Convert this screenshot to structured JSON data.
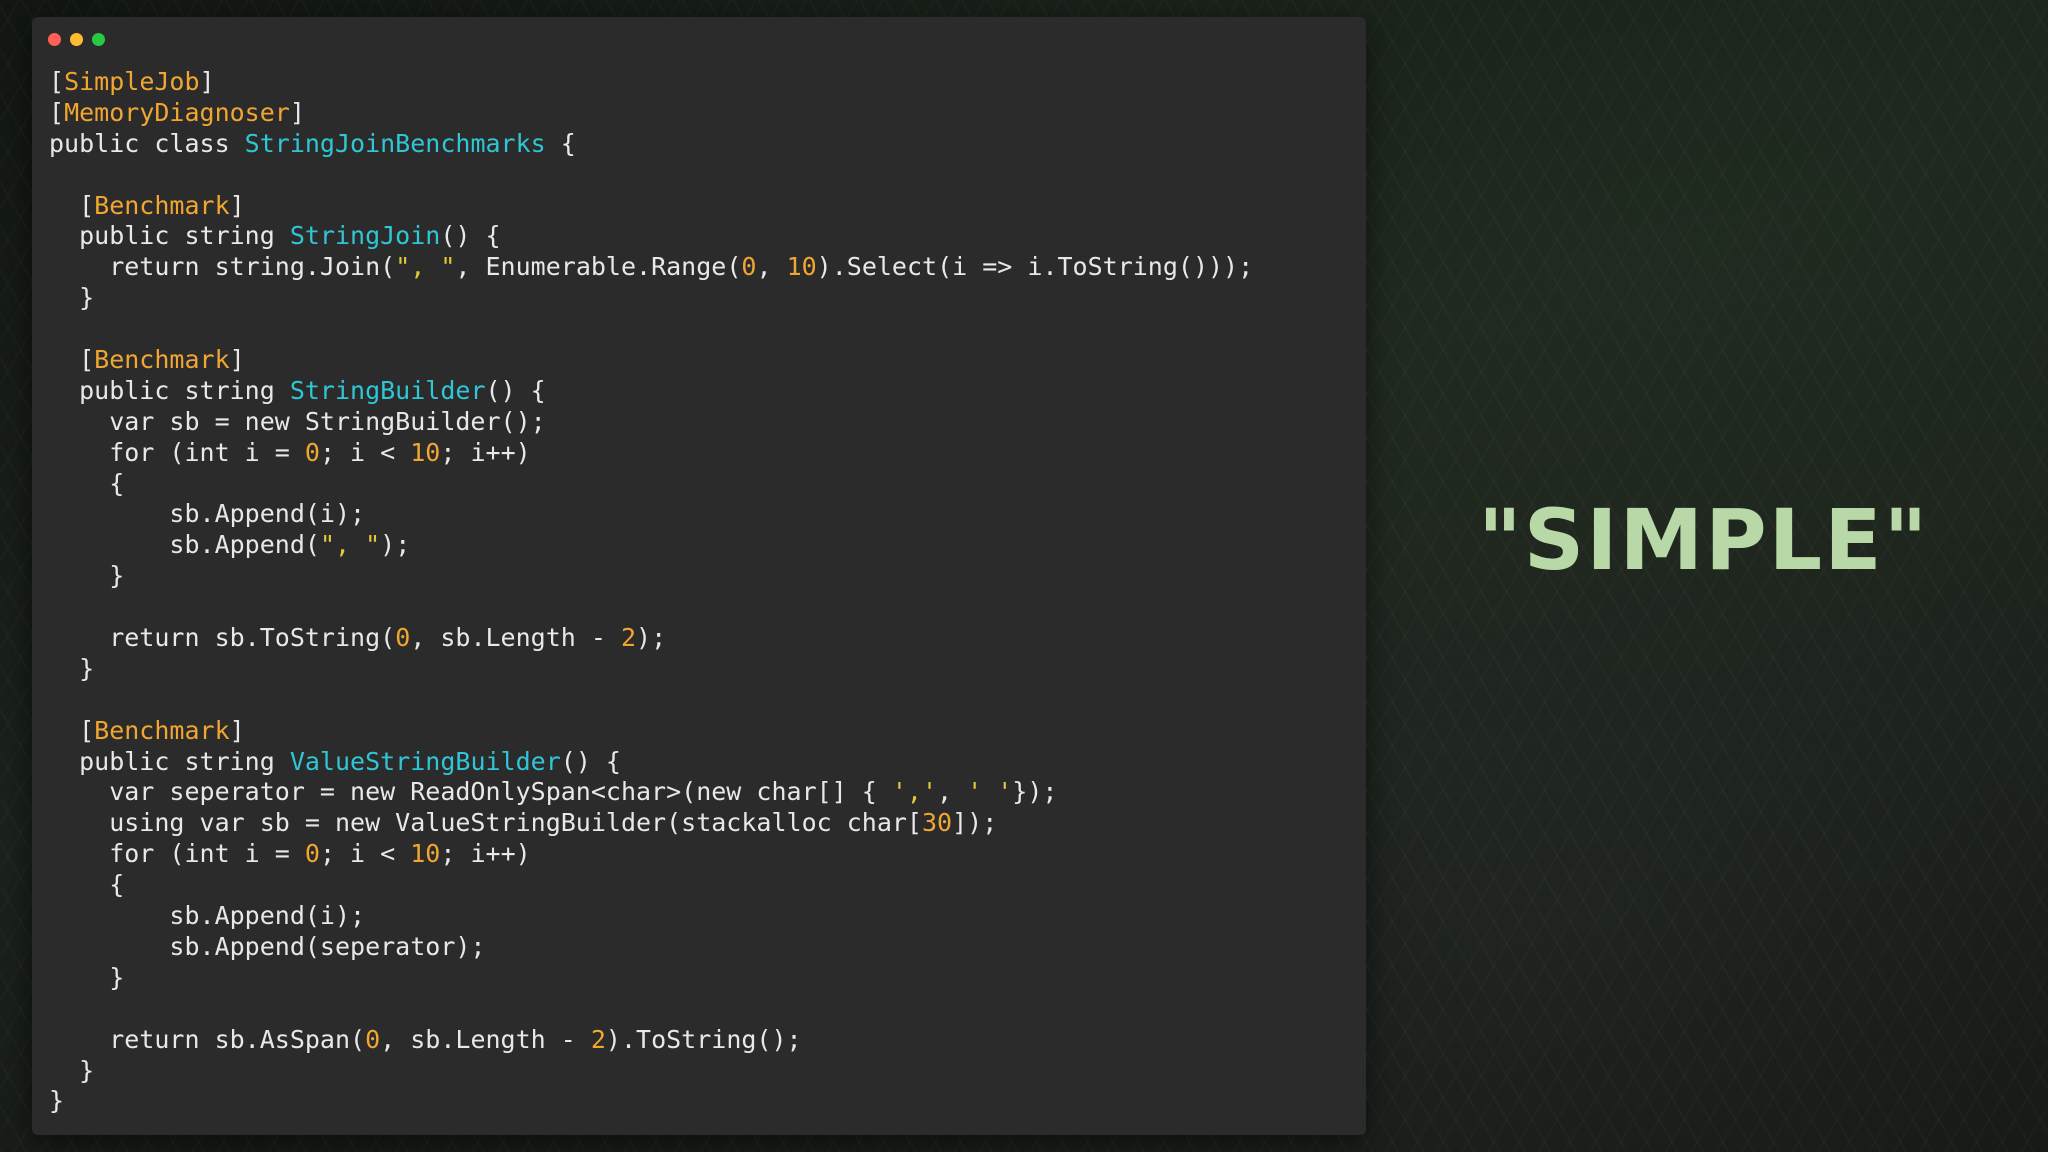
{
  "window": {
    "traffic_lights": [
      {
        "name": "close",
        "color": "#ff5f57"
      },
      {
        "name": "minimize",
        "color": "#febc2e"
      },
      {
        "name": "zoom",
        "color": "#28c840"
      }
    ]
  },
  "colors": {
    "window_bg": "#2b2b2b",
    "attribute": "#f0a631",
    "type_name": "#2fc6d6",
    "number": "#f0a631",
    "string": "#e5c838",
    "plain": "#e8e8e8",
    "side_title": "#b9d8a8"
  },
  "code_lines": [
    [
      {
        "t": "[",
        "k": "plain"
      },
      {
        "t": "SimpleJob",
        "k": "attr"
      },
      {
        "t": "]",
        "k": "plain"
      }
    ],
    [
      {
        "t": "[",
        "k": "plain"
      },
      {
        "t": "MemoryDiagnoser",
        "k": "attr"
      },
      {
        "t": "]",
        "k": "plain"
      }
    ],
    [
      {
        "t": "public class ",
        "k": "plain"
      },
      {
        "t": "StringJoinBenchmarks",
        "k": "type"
      },
      {
        "t": " {",
        "k": "plain"
      }
    ],
    [],
    [
      {
        "t": "  [",
        "k": "plain"
      },
      {
        "t": "Benchmark",
        "k": "attr"
      },
      {
        "t": "]",
        "k": "plain"
      }
    ],
    [
      {
        "t": "  public string ",
        "k": "plain"
      },
      {
        "t": "StringJoin",
        "k": "type"
      },
      {
        "t": "() {",
        "k": "plain"
      }
    ],
    [
      {
        "t": "    return string.Join(",
        "k": "plain"
      },
      {
        "t": "\", \"",
        "k": "str"
      },
      {
        "t": ", Enumerable.Range(",
        "k": "plain"
      },
      {
        "t": "0",
        "k": "num"
      },
      {
        "t": ", ",
        "k": "plain"
      },
      {
        "t": "10",
        "k": "num"
      },
      {
        "t": ").Select(i => i.ToString()));",
        "k": "plain"
      }
    ],
    [
      {
        "t": "  }",
        "k": "plain"
      }
    ],
    [],
    [
      {
        "t": "  [",
        "k": "plain"
      },
      {
        "t": "Benchmark",
        "k": "attr"
      },
      {
        "t": "]",
        "k": "plain"
      }
    ],
    [
      {
        "t": "  public string ",
        "k": "plain"
      },
      {
        "t": "StringBuilder",
        "k": "type"
      },
      {
        "t": "() {",
        "k": "plain"
      }
    ],
    [
      {
        "t": "    var sb = new StringBuilder();",
        "k": "plain"
      }
    ],
    [
      {
        "t": "    for (int i = ",
        "k": "plain"
      },
      {
        "t": "0",
        "k": "num"
      },
      {
        "t": "; i < ",
        "k": "plain"
      },
      {
        "t": "10",
        "k": "num"
      },
      {
        "t": "; i++)",
        "k": "plain"
      }
    ],
    [
      {
        "t": "    {",
        "k": "plain"
      }
    ],
    [
      {
        "t": "        sb.Append(i);",
        "k": "plain"
      }
    ],
    [
      {
        "t": "        sb.Append(",
        "k": "plain"
      },
      {
        "t": "\", \"",
        "k": "str"
      },
      {
        "t": ");",
        "k": "plain"
      }
    ],
    [
      {
        "t": "    }",
        "k": "plain"
      }
    ],
    [],
    [
      {
        "t": "    return sb.ToString(",
        "k": "plain"
      },
      {
        "t": "0",
        "k": "num"
      },
      {
        "t": ", sb.Length - ",
        "k": "plain"
      },
      {
        "t": "2",
        "k": "num"
      },
      {
        "t": ");",
        "k": "plain"
      }
    ],
    [
      {
        "t": "  }",
        "k": "plain"
      }
    ],
    [],
    [
      {
        "t": "  [",
        "k": "plain"
      },
      {
        "t": "Benchmark",
        "k": "attr"
      },
      {
        "t": "]",
        "k": "plain"
      }
    ],
    [
      {
        "t": "  public string ",
        "k": "plain"
      },
      {
        "t": "ValueStringBuilder",
        "k": "type"
      },
      {
        "t": "() {",
        "k": "plain"
      }
    ],
    [
      {
        "t": "    var seperator = new ReadOnlySpan<char>(new char[] { ",
        "k": "plain"
      },
      {
        "t": "','",
        "k": "str"
      },
      {
        "t": ", ",
        "k": "plain"
      },
      {
        "t": "' '",
        "k": "str"
      },
      {
        "t": "});",
        "k": "plain"
      }
    ],
    [
      {
        "t": "    using var sb = new ValueStringBuilder(stackalloc char[",
        "k": "plain"
      },
      {
        "t": "30",
        "k": "num"
      },
      {
        "t": "]);",
        "k": "plain"
      }
    ],
    [
      {
        "t": "    for (int i = ",
        "k": "plain"
      },
      {
        "t": "0",
        "k": "num"
      },
      {
        "t": "; i < ",
        "k": "plain"
      },
      {
        "t": "10",
        "k": "num"
      },
      {
        "t": "; i++)",
        "k": "plain"
      }
    ],
    [
      {
        "t": "    {",
        "k": "plain"
      }
    ],
    [
      {
        "t": "        sb.Append(i);",
        "k": "plain"
      }
    ],
    [
      {
        "t": "        sb.Append(seperator);",
        "k": "plain"
      }
    ],
    [
      {
        "t": "    }",
        "k": "plain"
      }
    ],
    [],
    [
      {
        "t": "    return sb.AsSpan(",
        "k": "plain"
      },
      {
        "t": "0",
        "k": "num"
      },
      {
        "t": ", sb.Length - ",
        "k": "plain"
      },
      {
        "t": "2",
        "k": "num"
      },
      {
        "t": ").ToString();",
        "k": "plain"
      }
    ],
    [
      {
        "t": "  }",
        "k": "plain"
      }
    ],
    [
      {
        "t": "}",
        "k": "plain"
      }
    ]
  ],
  "side_title": "\"SIMPLE\""
}
